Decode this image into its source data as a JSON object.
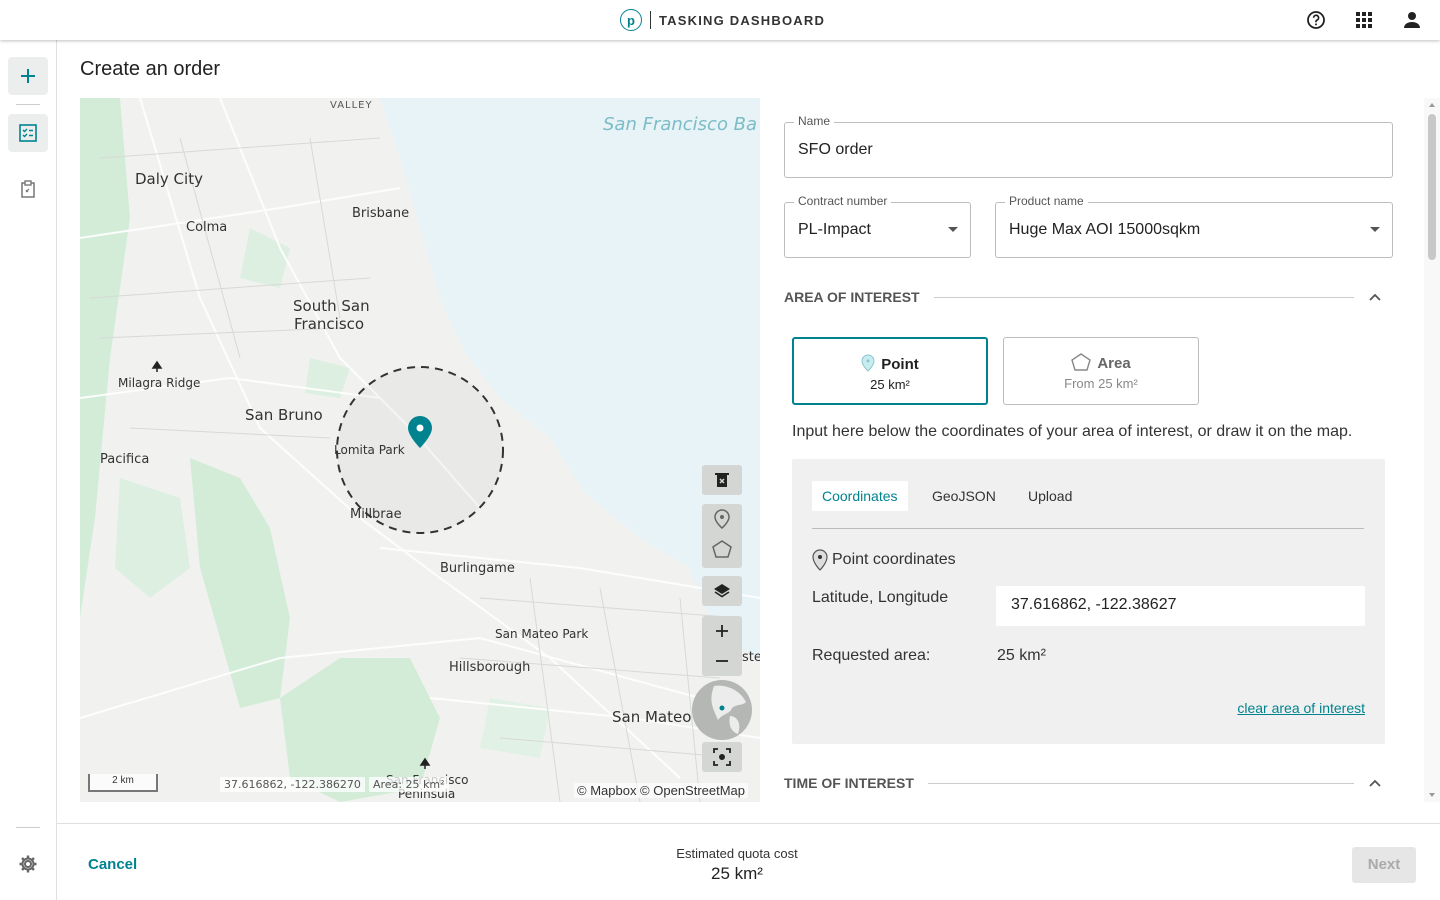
{
  "header": {
    "logo_letter": "p",
    "title": "TASKING DASHBOARD",
    "icons": [
      "help-icon",
      "apps-grid-icon",
      "account-icon"
    ]
  },
  "rail": {
    "icons": [
      "plus-icon",
      "orders-checklist-icon",
      "clipboard-icon",
      "settings-gear-icon"
    ]
  },
  "page": {
    "title": "Create an order"
  },
  "map": {
    "places": {
      "valley": "VALLEY",
      "bay": "San Francisco Ba",
      "daly_city": "Daly City",
      "colma": "Colma",
      "brisbane": "Brisbane",
      "ssf_line1": "South San",
      "ssf_line2": "Francisco",
      "milagra": "Milagra Ridge",
      "san_bruno": "San Bruno",
      "pacifica": "Pacifica",
      "lomita": "Lomita Park",
      "millbrae": "Millbrae",
      "burlingame": "Burlingame",
      "sm_park": "San Mateo Park",
      "hillsborough": "Hillsborough",
      "san_mateo": "San Mateo",
      "ste": "ste",
      "sf_peninsula_1": "San Francisco",
      "sf_peninsula_2": "Peninsula"
    },
    "scale": "2 km",
    "cursor_coords": "37.616862, -122.386270",
    "area_readout": "Area: 25 km²",
    "attribution": "© Mapbox © OpenStreetMap",
    "controls": [
      "delete-shape-icon",
      "point-tool-icon",
      "polygon-tool-icon",
      "layers-icon",
      "zoom-in-icon",
      "zoom-out-icon",
      "globe-minimap",
      "recenter-icon"
    ]
  },
  "form": {
    "name": {
      "label": "Name",
      "value": "SFO order"
    },
    "contract": {
      "label": "Contract number",
      "value": "PL-Impact"
    },
    "product": {
      "label": "Product name",
      "value": "Huge Max AOI 15000sqkm"
    },
    "aoi": {
      "title": "AREA OF INTEREST",
      "point": {
        "title": "Point",
        "sub": "25 km²"
      },
      "area": {
        "title": "Area",
        "sub": "From 25 km²"
      },
      "instructions": "Input here below the coordinates of your area of interest, or draw it on the map.",
      "tabs": [
        "Coordinates",
        "GeoJSON",
        "Upload"
      ],
      "active_tab": "Coordinates",
      "point_coords_title": "Point coordinates",
      "latlon_label": "Latitude, Longitude",
      "latlon_value": "37.616862, -122.38627",
      "requested_label": "Requested area:",
      "requested_value": "25 km²",
      "clear_link": "clear area of interest"
    },
    "toi": {
      "title": "TIME OF INTEREST"
    }
  },
  "footer": {
    "cancel": "Cancel",
    "quota_label": "Estimated quota cost",
    "quota_value": "25 km²",
    "next": "Next"
  },
  "colors": {
    "accent": "#00838f",
    "map_water": "#e7f3f6",
    "map_park": "#d3ecd8"
  }
}
